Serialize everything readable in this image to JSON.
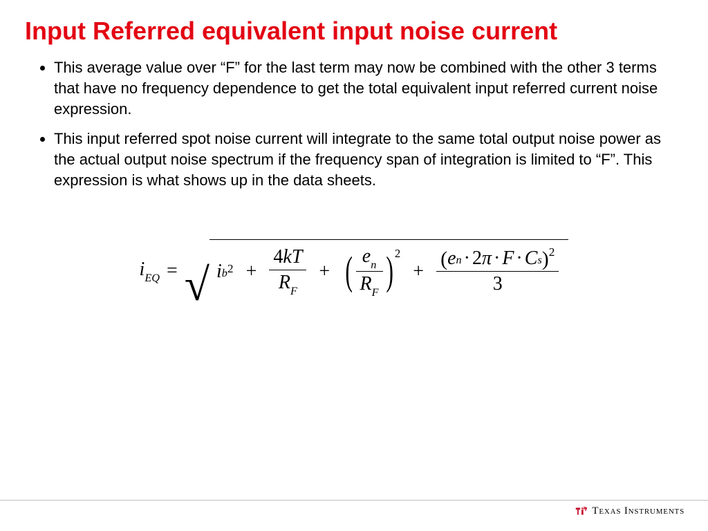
{
  "title": "Input Referred equivalent input noise current",
  "bullets": [
    "This average value over “F” for the last term may now be combined with the other 3 terms that have no frequency dependence to get the total equivalent input referred current noise expression.",
    "This input referred spot noise current  will integrate to the same total output noise power as the actual output noise spectrum if the frequency span of integration is limited to “F”. This expression is what shows up in the data sheets."
  ],
  "formula": {
    "lhs_var": "i",
    "lhs_sub": "EQ",
    "eq": "=",
    "t1_var": "i",
    "t1_sub": "b",
    "t1_sup": "2",
    "t2_num": "4kT",
    "t2_den_var": "R",
    "t2_den_sub": "F",
    "t3_num_var": "e",
    "t3_num_sub": "n",
    "t3_den_var": "R",
    "t3_den_sub": "F",
    "t3_sup": "2",
    "t4_e": "e",
    "t4_e_sub": "n",
    "t4_dot": "·",
    "t4_2pi": "2π",
    "t4_F": "F",
    "t4_C": "C",
    "t4_C_sub": "s",
    "t4_sup": "2",
    "t4_den": "3",
    "plus": "+"
  },
  "brand": "Texas Instruments"
}
